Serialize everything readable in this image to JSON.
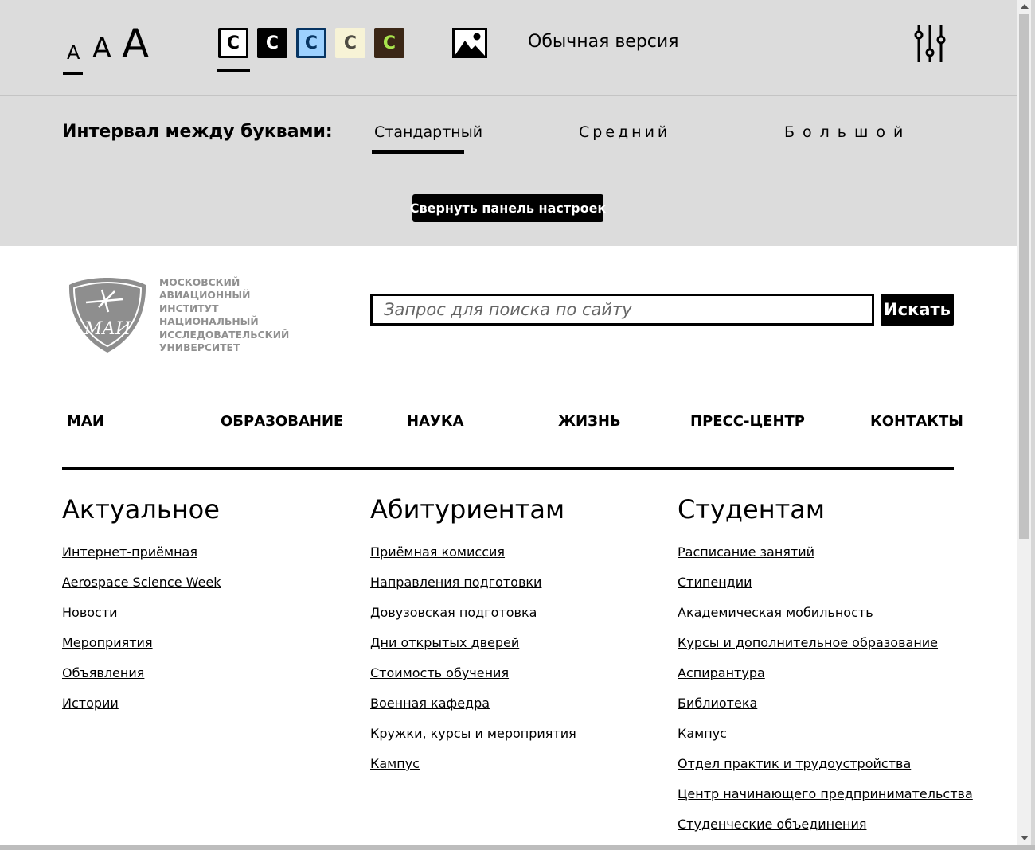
{
  "panel": {
    "font_sizes": [
      "A",
      "A",
      "A"
    ],
    "color_schemes": [
      {
        "label": "C",
        "bg": "#ffffff",
        "fg": "#000000"
      },
      {
        "label": "C",
        "bg": "#000000",
        "fg": "#ffffff"
      },
      {
        "label": "C",
        "bg": "#9dd1ff",
        "fg": "#063462"
      },
      {
        "label": "C",
        "bg": "#f7f3d6",
        "fg": "#4d4b43"
      },
      {
        "label": "C",
        "bg": "#3b2716",
        "fg": "#a9e44d"
      }
    ],
    "images_icon": "image-icon",
    "normal_version": "Обычная версия",
    "settings_icon": "sliders-icon",
    "spacing_label": "Интервал между буквами:",
    "spacing_options": [
      "Стандартный",
      "Средний",
      "Большой"
    ],
    "collapse_button": "Свернуть панель настроек"
  },
  "header": {
    "logo_emblem_text": "МАИ",
    "logo_lines": [
      "Московский",
      "авиационный",
      "институт",
      "национальный",
      "исследовательский",
      "университет"
    ],
    "search_placeholder": "Запрос для поиска по сайту",
    "search_button": "Искать"
  },
  "nav": [
    "МАИ",
    "ОБРАЗОВАНИЕ",
    "НАУКА",
    "ЖИЗНЬ",
    "ПРЕСС-ЦЕНТР",
    "КОНТАКТЫ"
  ],
  "columns": [
    {
      "title": "Актуальное",
      "links": [
        "Интернет-приёмная",
        "Aerospace Science Week",
        "Новости",
        "Мероприятия",
        "Объявления",
        "Истории"
      ]
    },
    {
      "title": "Абитуриентам",
      "links": [
        "Приёмная комиссия",
        "Направления подготовки",
        "Довузовская подготовка",
        "Дни открытых дверей",
        "Стоимость обучения",
        "Военная кафедра",
        "Кружки, курсы и мероприятия",
        "Кампус"
      ]
    },
    {
      "title": "Студентам",
      "links": [
        "Расписание занятий",
        "Стипендии",
        "Академическая мобильность",
        "Курсы и дополнительное образование",
        "Аспирантура",
        "Библиотека",
        "Кампус",
        "Отдел практик и трудоустройства",
        "Центр начинающего предпринимательства",
        "Студенческие объединения"
      ]
    }
  ]
}
